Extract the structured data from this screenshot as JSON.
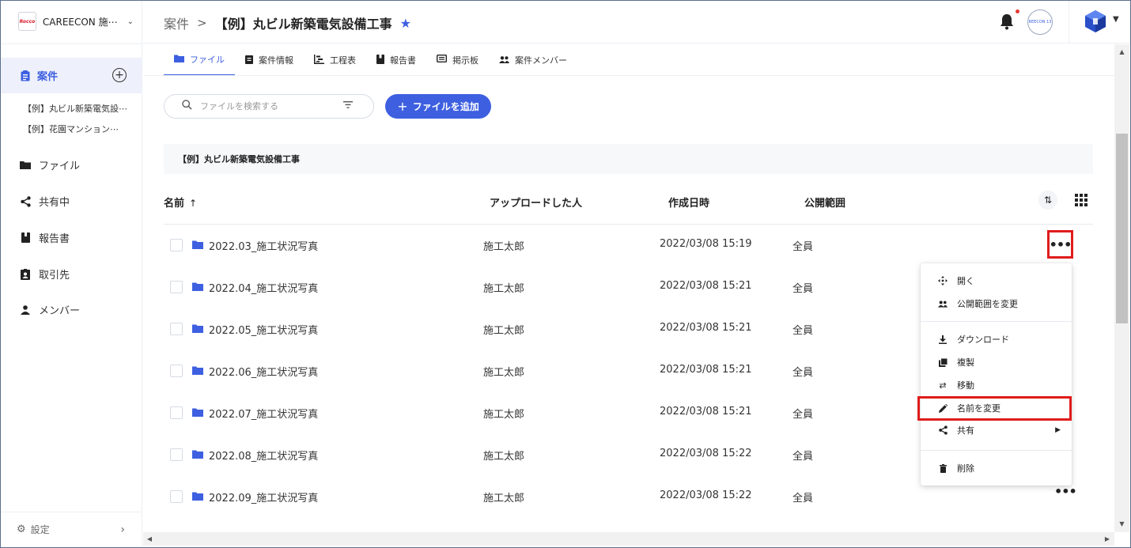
{
  "company": {
    "logo_text": "Rocco",
    "name": "CAREECON 施⋯"
  },
  "sidebar": {
    "active_label": "案件",
    "projects": [
      "【例】丸ビル新築電気設⋯",
      "【例】花園マンション⋯"
    ],
    "items": [
      {
        "label": "ファイル",
        "icon": "folder-icon"
      },
      {
        "label": "共有中",
        "icon": "share-icon"
      },
      {
        "label": "報告書",
        "icon": "book-icon"
      },
      {
        "label": "取引先",
        "icon": "contact-icon"
      },
      {
        "label": "メンバー",
        "icon": "person-icon"
      }
    ],
    "settings_label": "設定"
  },
  "header": {
    "breadcrumb_root": "案件",
    "breadcrumb_sep": ">",
    "breadcrumb_current": "【例】丸ビル新築電気設備工事",
    "org_avatar_text": "REECON 13"
  },
  "tabs": [
    {
      "label": "ファイル",
      "icon": "folder-icon",
      "active": true
    },
    {
      "label": "案件情報",
      "icon": "clipboard-icon"
    },
    {
      "label": "工程表",
      "icon": "gantt-icon"
    },
    {
      "label": "報告書",
      "icon": "book-icon"
    },
    {
      "label": "掲示板",
      "icon": "board-icon"
    },
    {
      "label": "案件メンバー",
      "icon": "people-icon"
    }
  ],
  "search": {
    "placeholder": "ファイルを検索する"
  },
  "add_button": "ファイルを追加",
  "folder_path": "【例】丸ビル新築電気設備工事",
  "columns": {
    "name": "名前",
    "uploader": "アップロードした人",
    "created": "作成日時",
    "scope": "公開範囲"
  },
  "rows": [
    {
      "name": "2022.03_施工状況写真",
      "uploader": "施工太郎",
      "created": "2022/03/08 15:19",
      "scope": "全員"
    },
    {
      "name": "2022.04_施工状況写真",
      "uploader": "施工太郎",
      "created": "2022/03/08 15:21",
      "scope": "全員"
    },
    {
      "name": "2022.05_施工状況写真",
      "uploader": "施工太郎",
      "created": "2022/03/08 15:21",
      "scope": "全員"
    },
    {
      "name": "2022.06_施工状況写真",
      "uploader": "施工太郎",
      "created": "2022/03/08 15:21",
      "scope": "全員"
    },
    {
      "name": "2022.07_施工状況写真",
      "uploader": "施工太郎",
      "created": "2022/03/08 15:21",
      "scope": "全員"
    },
    {
      "name": "2022.08_施工状況写真",
      "uploader": "施工太郎",
      "created": "2022/03/08 15:22",
      "scope": "全員"
    },
    {
      "name": "2022.09_施工状況写真",
      "uploader": "施工太郎",
      "created": "2022/03/08 15:22",
      "scope": "全員"
    }
  ],
  "context_menu": {
    "open": "開く",
    "change_scope": "公開範囲を変更",
    "download": "ダウンロード",
    "duplicate": "複製",
    "move": "移動",
    "rename": "名前を変更",
    "share": "共有",
    "delete": "削除"
  },
  "colors": {
    "accent": "#3d5fe0",
    "highlight": "#e01c1c",
    "notification": "#e53935"
  }
}
